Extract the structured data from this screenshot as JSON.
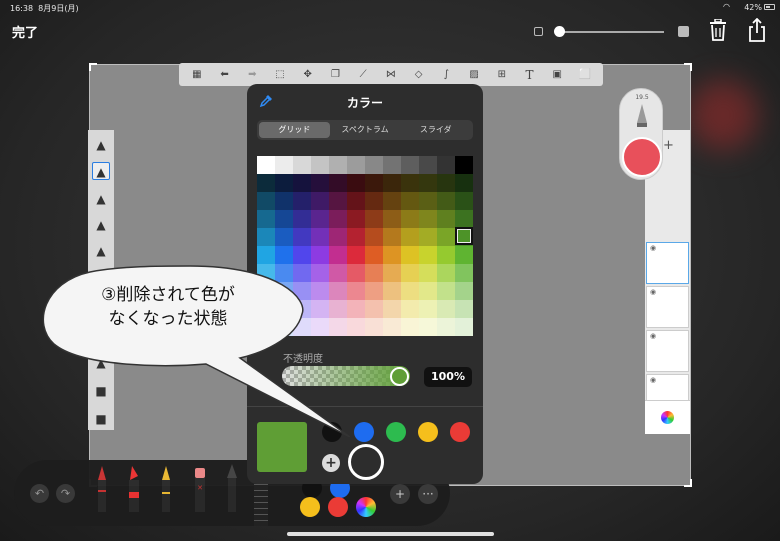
{
  "status": {
    "time": "16:38",
    "date": "8月9日(月)",
    "battery": "42%"
  },
  "header": {
    "done_label": "完了"
  },
  "color_panel": {
    "title": "カラー",
    "tabs": [
      {
        "label": "グリッド",
        "selected": true
      },
      {
        "label": "スペクトラム",
        "selected": false
      },
      {
        "label": "スライダ",
        "selected": false
      }
    ],
    "opacity_label": "不透明度",
    "opacity_value": "100%",
    "current_color": "#5f9e35",
    "palette": [
      "#111111",
      "#1e6cf0",
      "#2dbb4f",
      "#f5bf1c",
      "#ea3b36"
    ],
    "grid_rows": [
      [
        "#ffffff",
        "#ececec",
        "#d8d8d8",
        "#c4c4c4",
        "#b0b0b0",
        "#9c9c9c",
        "#888888",
        "#737373",
        "#5e5e5e",
        "#494949",
        "#333333",
        "#000000"
      ],
      [
        "#0c2b3b",
        "#0c1c3d",
        "#15123d",
        "#250f3b",
        "#330c27",
        "#3a0c10",
        "#3b180b",
        "#3b260b",
        "#3a330c",
        "#34370e",
        "#27350f",
        "#17300f"
      ],
      [
        "#114a66",
        "#10326a",
        "#24206a",
        "#3f1a66",
        "#561541",
        "#641319",
        "#652911",
        "#654210",
        "#645811",
        "#5a5f15",
        "#435b17",
        "#2a5117"
      ],
      [
        "#166990",
        "#154795",
        "#332d95",
        "#5a258f",
        "#7b1d5b",
        "#8b1a22",
        "#8d3b18",
        "#8d5d17",
        "#8c7b18",
        "#7f861d",
        "#5f801f",
        "#3c7220"
      ],
      [
        "#1b87b9",
        "#1a5cc0",
        "#4239c0",
        "#7330b8",
        "#9e2675",
        "#b42230",
        "#b54c1e",
        "#b4791d",
        "#b49f1e",
        "#a3ac25",
        "#7aa527",
        "#4d9328"
      ],
      [
        "#20a5e3",
        "#1f71ec",
        "#5146ec",
        "#8d3be2",
        "#c22e90",
        "#dc2a3b",
        "#de5d24",
        "#dd9423",
        "#ddc224",
        "#c8d32d",
        "#95ca2f",
        "#5fb431"
      ],
      [
        "#46b9ea",
        "#4a8af0",
        "#7169f0",
        "#a562e8",
        "#d059a6",
        "#e55a66",
        "#e77f55",
        "#e6ab52",
        "#e6d053",
        "#d5de5b",
        "#abd65d",
        "#81c45e"
      ],
      [
        "#72cbef",
        "#7aa8f4",
        "#9890f4",
        "#bc8bee",
        "#dc86bc",
        "#ec8790",
        "#ee9f83",
        "#edc17f",
        "#edde81",
        "#e2e88a",
        "#c2e18b",
        "#a4d38b"
      ],
      [
        "#a0dcf4",
        "#a7c4f7",
        "#bdb7f7",
        "#d4b4f3",
        "#e8b2d2",
        "#f3b3b9",
        "#f4c1ae",
        "#f3d6ab",
        "#f3ebad",
        "#edf1b4",
        "#d9eab4",
        "#c7e3b4"
      ],
      [
        "#d0eefa",
        "#d4e2fb",
        "#dfdbfb",
        "#eadafa",
        "#f4d8e8",
        "#f9d9dc",
        "#f9e0d6",
        "#f9ead5",
        "#f9f5d6",
        "#f6f8d9",
        "#ecf4d9",
        "#e3f1d9"
      ]
    ]
  },
  "callout": {
    "line1": "③削除されて色が",
    "line2": "なくなった状態"
  },
  "brush": {
    "size": "19.5",
    "color": "#e8505b"
  },
  "bottom_palette": [
    "#111111",
    "#1e6cf0",
    "#f5bf1c",
    "#ea3b36"
  ],
  "accent": "#2f8bf5"
}
